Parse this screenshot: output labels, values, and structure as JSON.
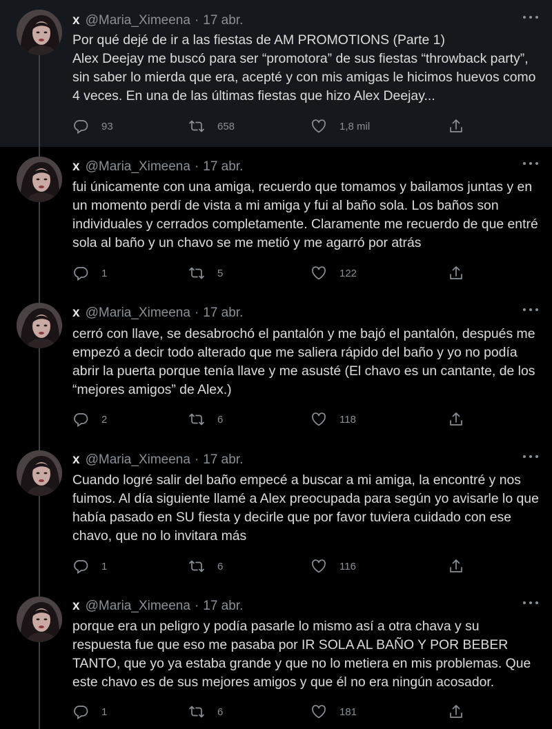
{
  "author": {
    "name": "x",
    "handle": "@Maria_Ximeena",
    "separator": "·",
    "date": "17 abr."
  },
  "icons": [
    "reply-icon",
    "retweet-icon",
    "like-icon",
    "share-icon",
    "more-icon"
  ],
  "colors": {
    "background": "#000000",
    "first_tweet_bg": "#15181c",
    "muted": "#8a9097",
    "text": "#dcdcdc"
  },
  "tweets": [
    {
      "text": "Por qué dejé de ir a las fiestas de AM PROMOTIONS (Parte 1)\nAlex Deejay me buscó para ser “promotora” de sus fiestas “throwback party”, sin saber lo mierda que era, acepté y con mis amigas le hicimos huevos como 4 veces. En una de las últimas fiestas que hizo Alex Deejay...",
      "replies": "93",
      "retweets": "658",
      "likes": "1,8 mil"
    },
    {
      "text": "fui únicamente con una amiga, recuerdo que tomamos y bailamos juntas y en un momento perdí de vista a mi amiga y fui al baño sola. Los baños son individuales y cerrados completamente. Claramente me recuerdo de que entré sola al baño y un chavo se me metió y me agarró por atrás",
      "replies": "1",
      "retweets": "5",
      "likes": "122"
    },
    {
      "text": "cerró con llave, se desabrochó el pantalón y me bajó el pantalón, después me empezó a decir todo alterado que me saliera rápido del baño y yo no podía abrir la puerta porque tenía llave y me asusté (El chavo es un cantante, de los “mejores amigos” de Alex.)",
      "replies": "2",
      "retweets": "6",
      "likes": "118"
    },
    {
      "text": "Cuando logré salir del baño empecé a buscar a mi amiga, la encontré y nos fuimos. Al día siguiente llamé a Alex preocupada para según yo avisarle lo que había pasado en SU fiesta y decirle que por favor tuviera cuidado con ese chavo, que no lo invitara más",
      "replies": "1",
      "retweets": "6",
      "likes": "116"
    },
    {
      "text": "porque era un peligro y podía pasarle lo mismo así a otra chava y su respuesta fue que eso me pasaba por IR SOLA AL BAÑO Y POR BEBER TANTO, que yo ya estaba grande y que no lo metiera en mis problemas. Que este chavo es de sus mejores amigos y que él no era ningún acosador.",
      "replies": "1",
      "retweets": "6",
      "likes": "181"
    }
  ]
}
